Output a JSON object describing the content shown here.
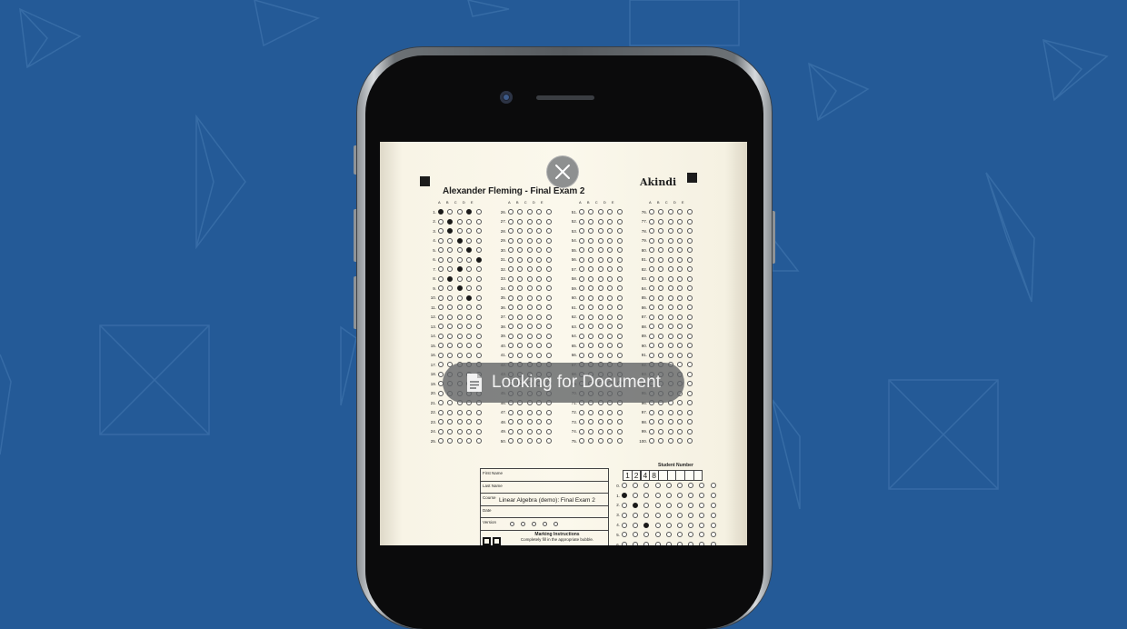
{
  "background_color": "#245a97",
  "overlay": {
    "close_icon": "close-icon",
    "status_icon": "document-icon",
    "status_text": "Looking for Document"
  },
  "sheet": {
    "title": "Alexander Fleming - Final Exam 2",
    "brand": "Akindi",
    "option_letters": [
      "A",
      "B",
      "C",
      "D",
      "E"
    ],
    "columns": [
      {
        "start": 1,
        "end": 25
      },
      {
        "start": 26,
        "end": 50
      },
      {
        "start": 51,
        "end": 75
      },
      {
        "start": 76,
        "end": 100
      }
    ],
    "filled_answers": {
      "1": [
        0,
        3
      ],
      "2": [
        1
      ],
      "3": [
        1
      ],
      "4": [
        2
      ],
      "5": [
        3
      ],
      "6": [
        4
      ],
      "7": [
        2
      ],
      "8": [
        1
      ],
      "9": [
        2
      ],
      "10": [
        3
      ]
    },
    "fields": {
      "first_name": "First Name",
      "last_name": "Last Name",
      "course_label": "Course",
      "course_value": "Linear Algebra (demo): Final Exam 2",
      "date": "Date",
      "version": "Version"
    },
    "marking_title": "Marking Instructions",
    "marking_text": "Completely fill in the appropriate bubble.",
    "student_number_label": "Student Number",
    "student_number_digits": [
      "1",
      "2",
      "4",
      "8",
      "",
      "",
      "",
      "",
      ""
    ],
    "student_number_filled": {
      "1": 0,
      "2": 1,
      "4": 2
    }
  }
}
